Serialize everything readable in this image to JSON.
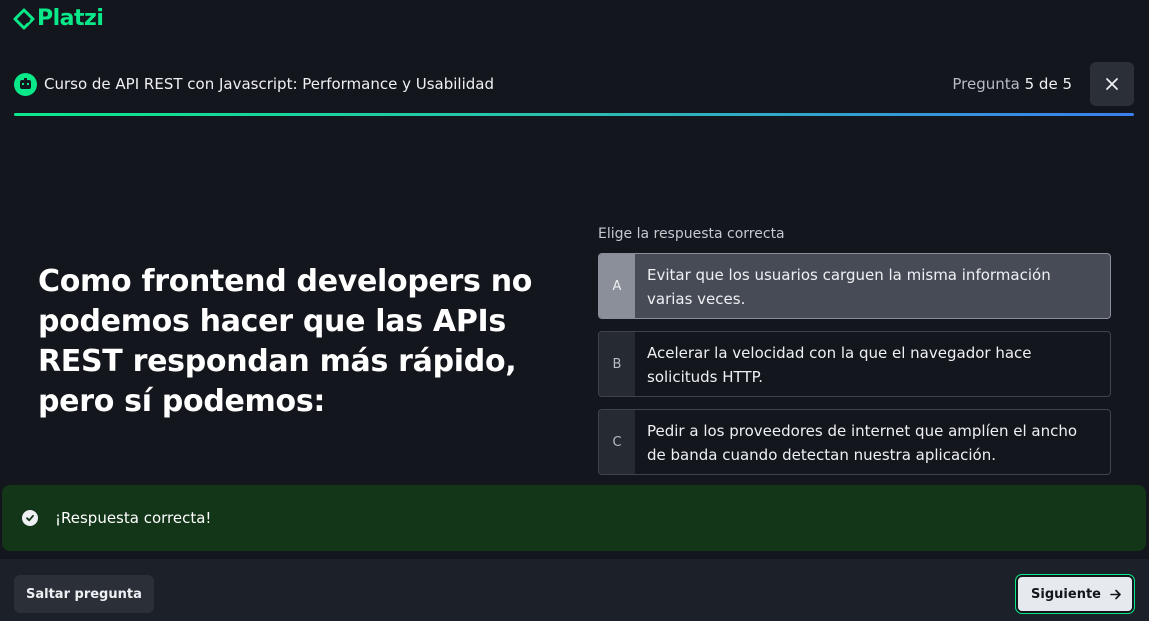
{
  "brand": {
    "name": "Platzi",
    "accent": "#0ae98a"
  },
  "header": {
    "course_title": "Curso de API REST con Javascript: Performance y Usabilidad",
    "progress_prefix": "Pregunta",
    "progress_value": "5 de 5",
    "progress_fraction": 1.0,
    "close_icon": "close-icon"
  },
  "question": {
    "text": "Como frontend developers no podemos hacer que las APIs REST respondan más rápido, pero sí podemos:"
  },
  "answers": {
    "label": "Elige la respuesta correcta",
    "options": [
      {
        "letter": "A",
        "text": "Evitar que los usuarios carguen la misma información varias veces.",
        "selected": true
      },
      {
        "letter": "B",
        "text": "Acelerar la velocidad con la que el navegador hace solicituds HTTP.",
        "selected": false
      },
      {
        "letter": "C",
        "text": "Pedir a los proveedores de internet que amplíen el ancho de banda cuando detectan nuestra aplicación.",
        "selected": false
      }
    ]
  },
  "feedback": {
    "text": "¡Respuesta correcta!",
    "color": "#133518"
  },
  "footer": {
    "skip_label": "Saltar pregunta",
    "next_label": "Siguiente"
  }
}
